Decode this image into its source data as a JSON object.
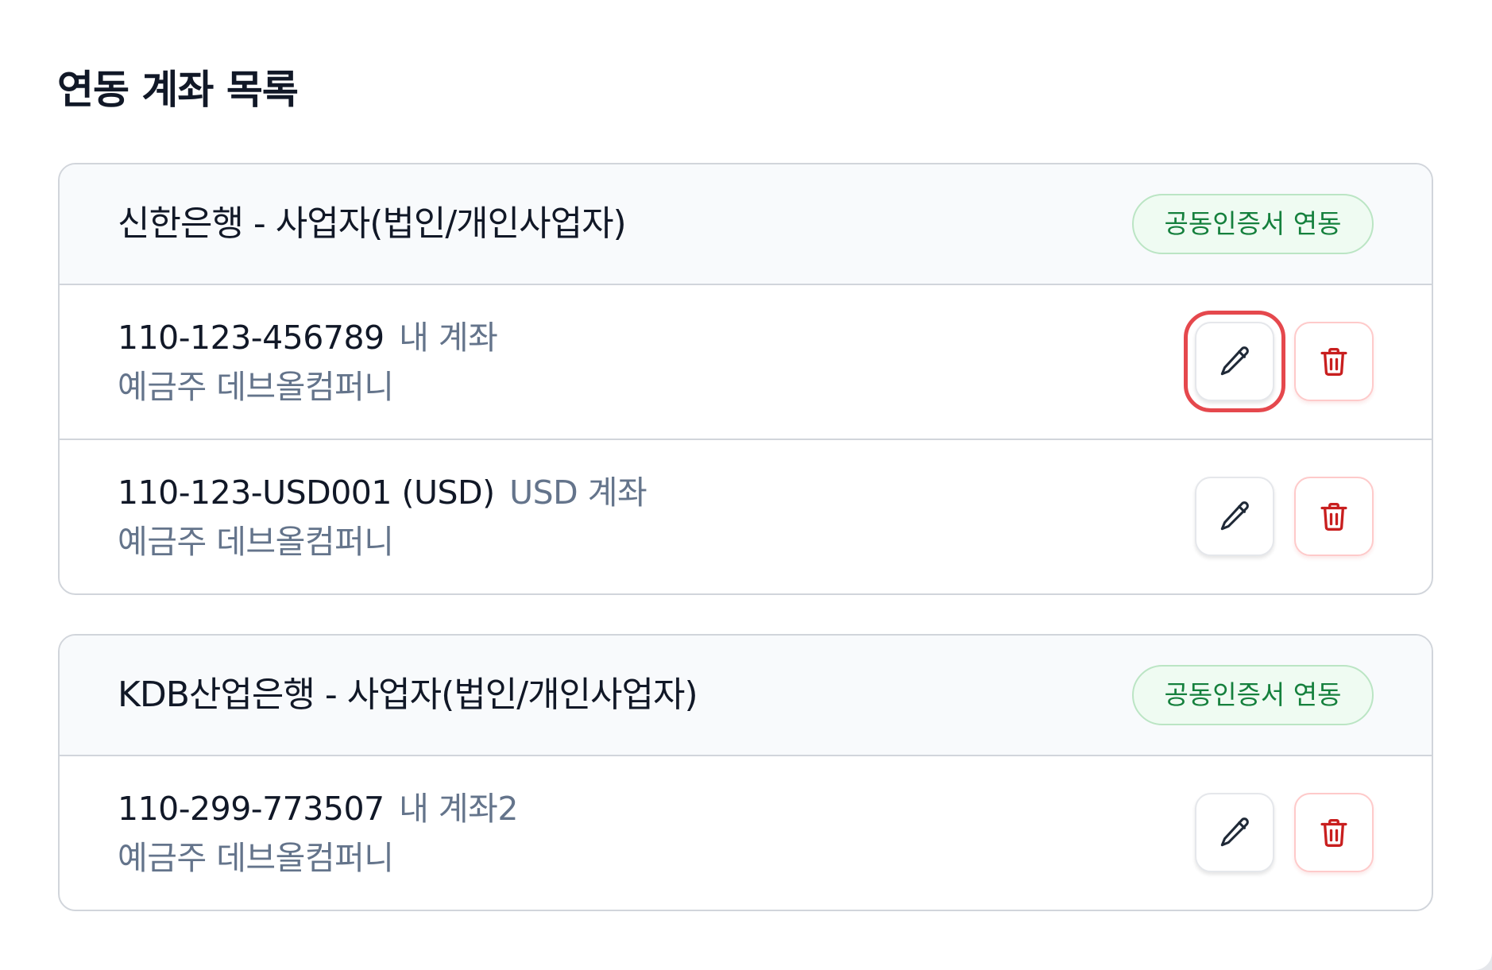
{
  "section": {
    "title": "연동 계좌 목록"
  },
  "banks": [
    {
      "name": "신한은행 - 사업자(법인/개인사업자)",
      "badge": "공동인증서 연동",
      "accounts": [
        {
          "number": "110-123-456789",
          "alias": "내 계좌",
          "holder": "예금주 데브올컴퍼니"
        },
        {
          "number": "110-123-USD001 (USD)",
          "alias": "USD 계좌",
          "holder": "예금주 데브올컴퍼니"
        }
      ]
    },
    {
      "name": "KDB산업은행 - 사업자(법인/개인사업자)",
      "badge": "공동인증서 연동",
      "accounts": [
        {
          "number": "110-299-773507",
          "alias": "내 계좌2",
          "holder": "예금주 데브올컴퍼니"
        }
      ]
    }
  ],
  "icons": {
    "edit": "pencil-icon",
    "delete": "trash-icon"
  },
  "colors": {
    "badge_text": "#15803d",
    "badge_bg": "#effbf2",
    "delete_icon": "#c81e1e",
    "focus_ring": "#e5484d",
    "muted_text": "#64748b"
  }
}
